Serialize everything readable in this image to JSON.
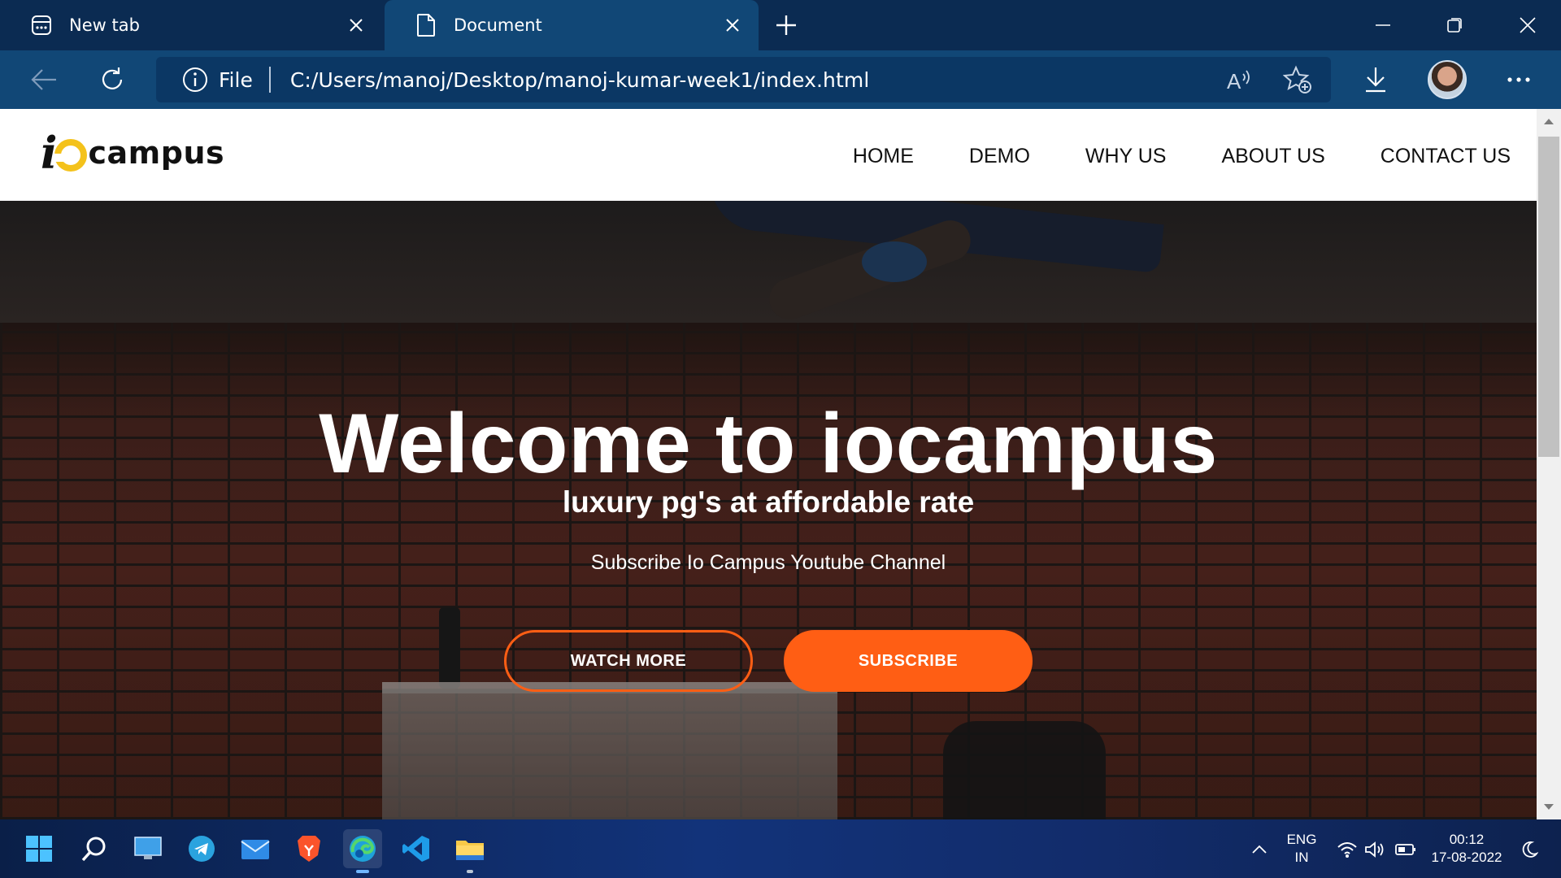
{
  "browser": {
    "tabs": [
      {
        "title": "New tab"
      },
      {
        "title": "Document"
      }
    ],
    "address": {
      "scheme_label": "File",
      "url": "C:/Users/manoj/Desktop/manoj-kumar-week1/index.html"
    }
  },
  "site": {
    "logo": {
      "i": "i",
      "text": "campus"
    },
    "nav": [
      "HOME",
      "DEMO",
      "WHY US",
      "ABOUT US",
      "CONTACT US"
    ],
    "hero": {
      "title": "Welcome to iocampus",
      "subtitle": "luxury pg's at affordable rate",
      "tagline": "Subscribe Io Campus Youtube Channel",
      "watch_label": "WATCH MORE",
      "subscribe_label": "SUBSCRIBE"
    }
  },
  "taskbar": {
    "apps": [
      "start-icon",
      "search-icon",
      "desktop-icon",
      "telegram-icon",
      "mail-icon",
      "brave-icon",
      "edge-icon",
      "vscode-icon",
      "file-explorer-icon"
    ],
    "language": {
      "line1": "ENG",
      "line2": "IN"
    },
    "clock": {
      "time": "00:12",
      "date": "17-08-2022"
    }
  },
  "colors": {
    "accent": "#ff5e14",
    "tab_strip": "#0b2b52",
    "toolbar": "#114776"
  }
}
